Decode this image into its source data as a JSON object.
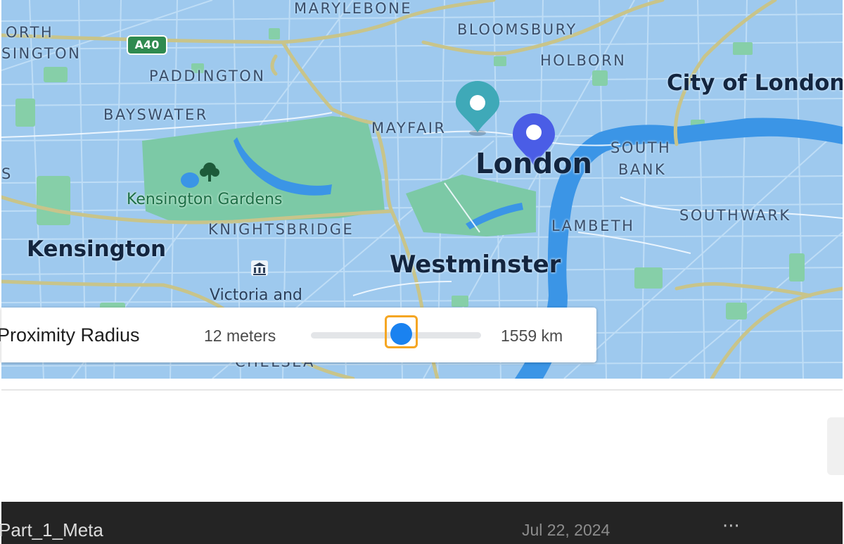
{
  "map": {
    "districts": {
      "marylebone": "MARYLEBONE",
      "north_kensington_1": "ORTH",
      "north_kensington_2": "SINGTON",
      "bloomsbury": "BLOOMSBURY",
      "holborn": "HOLBORN",
      "paddington": "PADDINGTON",
      "bayswater": "BAYSWATER",
      "mayfair": "MAYFAIR",
      "south_bank_1": "SOUTH",
      "south_bank_2": "BANK",
      "knightsbridge": "KNIGHTSBRIDGE",
      "lambeth": "LAMBETH",
      "southwark": "SOUTHWARK",
      "chelsea": "CHELSEA",
      "edge_s": "S"
    },
    "cities": {
      "city_of_london": "City of London",
      "london": "London",
      "kensington": "Kensington",
      "westminster": "Westminster"
    },
    "places": {
      "kensington_gardens": "Kensington Gardens",
      "victoria_and": "Victoria and"
    },
    "road_shield": "A40",
    "markers": [
      {
        "name": "teal-marker",
        "color": "#3fa9b8"
      },
      {
        "name": "blue-marker",
        "color": "#4a5de6"
      }
    ],
    "colors": {
      "water": "#3b95e6",
      "park": "#7cc9a6",
      "road_major": "#c8c48a",
      "base": "#9ec9ee"
    }
  },
  "slider": {
    "title": "Proximity Radius",
    "min_label": "12 meters",
    "max_label": "1559 km",
    "position_fraction": 0.53,
    "accent": "#1a82f0",
    "focus_color": "#f5a623"
  },
  "file_row": {
    "name": "Part_1_Meta",
    "date": "Jul 22, 2024",
    "more": "···"
  }
}
